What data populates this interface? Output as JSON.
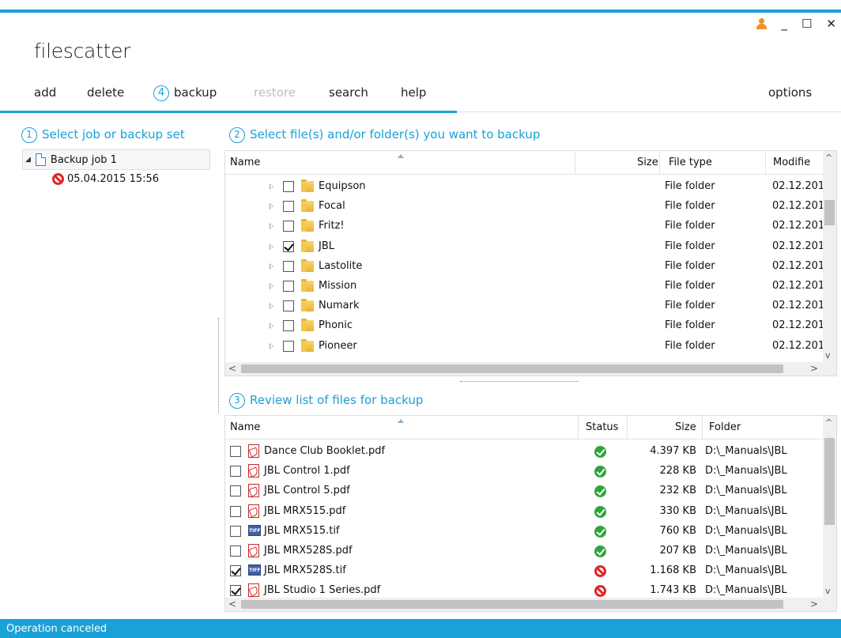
{
  "app": {
    "title": "filescatter",
    "status": "Operation canceled",
    "accent_color": "#1aa1d6",
    "window_controls": {
      "user_icon": "user-icon",
      "minimize": "_",
      "maximize": "☐",
      "close": "✕"
    }
  },
  "menu": {
    "add": "add",
    "delete": "delete",
    "backup_num": "4",
    "backup": "backup",
    "restore": "restore",
    "search": "search",
    "help": "help",
    "options": "options"
  },
  "jobs": {
    "num": "1",
    "title": "Select job or backup set",
    "job_name": "Backup job 1",
    "backup_set": "05.04.2015 15:56"
  },
  "files": {
    "num": "2",
    "title": "Select file(s) and/or folder(s) you want to backup",
    "columns": {
      "name": "Name",
      "size": "Size",
      "type": "File type",
      "modified": "Modifie"
    },
    "rows": [
      {
        "name": "Equipson",
        "type": "File folder",
        "modified": "02.12.201",
        "checked": false
      },
      {
        "name": "Focal",
        "type": "File folder",
        "modified": "02.12.201",
        "checked": false
      },
      {
        "name": "Fritz!",
        "type": "File folder",
        "modified": "02.12.201",
        "checked": false
      },
      {
        "name": "JBL",
        "type": "File folder",
        "modified": "02.12.201",
        "checked": true
      },
      {
        "name": "Lastolite",
        "type": "File folder",
        "modified": "02.12.201",
        "checked": false
      },
      {
        "name": "Mission",
        "type": "File folder",
        "modified": "02.12.201",
        "checked": false
      },
      {
        "name": "Numark",
        "type": "File folder",
        "modified": "02.12.201",
        "checked": false
      },
      {
        "name": "Phonic",
        "type": "File folder",
        "modified": "02.12.201",
        "checked": false
      },
      {
        "name": "Pioneer",
        "type": "File folder",
        "modified": "02.12.201",
        "checked": false
      }
    ]
  },
  "review": {
    "num": "3",
    "title": "Review list of files for backup",
    "columns": {
      "name": "Name",
      "status": "Status",
      "size": "Size",
      "folder": "Folder"
    },
    "rows": [
      {
        "name": "Dance Club Booklet.pdf",
        "icon": "pdf",
        "status": "ok",
        "size": "4.397 KB",
        "folder": "D:\\_Manuals\\JBL",
        "checked": false
      },
      {
        "name": "JBL Control 1.pdf",
        "icon": "pdf",
        "status": "ok",
        "size": "228 KB",
        "folder": "D:\\_Manuals\\JBL",
        "checked": false
      },
      {
        "name": "JBL Control 5.pdf",
        "icon": "pdf",
        "status": "ok",
        "size": "232 KB",
        "folder": "D:\\_Manuals\\JBL",
        "checked": false
      },
      {
        "name": "JBL MRX515.pdf",
        "icon": "pdf",
        "status": "ok",
        "size": "330 KB",
        "folder": "D:\\_Manuals\\JBL",
        "checked": false
      },
      {
        "name": "JBL MRX515.tif",
        "icon": "tif",
        "status": "ok",
        "size": "760 KB",
        "folder": "D:\\_Manuals\\JBL",
        "checked": false
      },
      {
        "name": "JBL MRX528S.pdf",
        "icon": "pdf",
        "status": "ok",
        "size": "207 KB",
        "folder": "D:\\_Manuals\\JBL",
        "checked": false
      },
      {
        "name": "JBL MRX528S.tif",
        "icon": "tif",
        "status": "error",
        "size": "1.168 KB",
        "folder": "D:\\_Manuals\\JBL",
        "checked": true
      },
      {
        "name": "JBL Studio 1 Series.pdf",
        "icon": "pdf",
        "status": "error",
        "size": "1.743 KB",
        "folder": "D:\\_Manuals\\JBL",
        "checked": true
      }
    ]
  }
}
